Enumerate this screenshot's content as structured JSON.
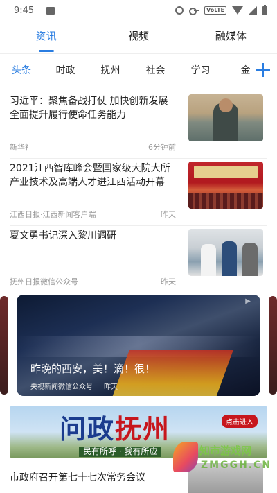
{
  "status_bar": {
    "time": "9:45",
    "volte": "VoLTE",
    "icons": [
      "image-icon",
      "alarm-icon",
      "key-icon",
      "volte-badge",
      "wifi-icon",
      "signal-icon",
      "battery-icon"
    ]
  },
  "main_tabs": [
    {
      "label": "资讯",
      "active": true
    },
    {
      "label": "视频",
      "active": false
    },
    {
      "label": "融媒体",
      "active": false
    }
  ],
  "channels": [
    {
      "label": "头条",
      "active": true
    },
    {
      "label": "时政"
    },
    {
      "label": "抚州"
    },
    {
      "label": "社会"
    },
    {
      "label": "学习"
    },
    {
      "label": "金"
    }
  ],
  "accent_color": "#2a7de1",
  "news": [
    {
      "title": "习近平：聚焦备战打仗 加快创新发展 全面提升履行使命任务能力",
      "source": "新华社",
      "time": "6分钟前"
    },
    {
      "title": "2021江西智库峰会暨国家级大院大所产业技术及高端人才进江西活动开幕",
      "source": "江西日报·江西新闻客户端",
      "time": "昨天"
    },
    {
      "title": "夏文勇书记深入黎川调研",
      "source": "抚州日报微信公众号",
      "time": "昨天"
    }
  ],
  "video": {
    "title": "昨晚的西安，美！滴！很！",
    "source": "央视新闻微信公众号",
    "time": "昨天"
  },
  "banner": {
    "title_blue": "问政",
    "title_red": "抚州",
    "subtitle": "民有所呼 · 我有所应",
    "button": "点击进入"
  },
  "last_news": {
    "title": "市政府召开第七十七次常务会议"
  },
  "watermark": {
    "line1": "知市游戏网",
    "line2": "ZMGGH.CN"
  }
}
